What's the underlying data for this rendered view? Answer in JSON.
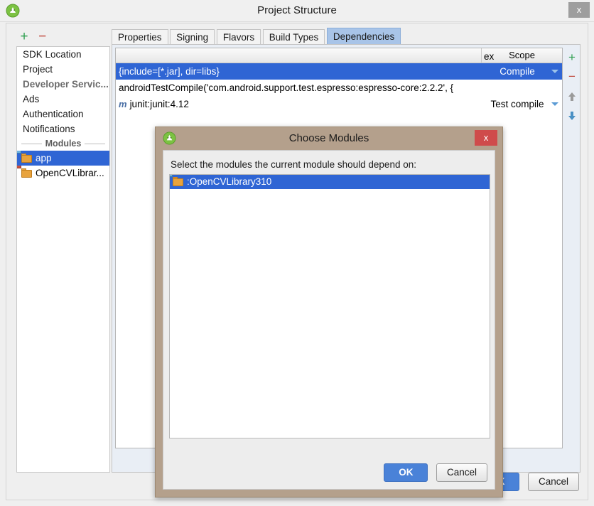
{
  "window": {
    "title": "Project Structure",
    "app_icon": "android-studio-icon",
    "close_label": "x"
  },
  "left_toolbar": {
    "add_label": "+",
    "remove_label": "−"
  },
  "sidebar": {
    "items": [
      {
        "label": "SDK Location",
        "type": "item"
      },
      {
        "label": "Project",
        "type": "item"
      },
      {
        "label": "Developer Servic...",
        "type": "group"
      },
      {
        "label": "Ads",
        "type": "item"
      },
      {
        "label": "Authentication",
        "type": "item"
      },
      {
        "label": "Notifications",
        "type": "item"
      }
    ],
    "modules_separator": "Modules",
    "modules": [
      {
        "label": "app",
        "icon": "module-folder-icon",
        "selected": true
      },
      {
        "label": "OpenCVLibrar...",
        "icon": "library-folder-icon",
        "selected": false
      }
    ]
  },
  "tabs": [
    {
      "label": "Properties",
      "active": false
    },
    {
      "label": "Signing",
      "active": false
    },
    {
      "label": "Flavors",
      "active": false
    },
    {
      "label": "Build Types",
      "active": false
    },
    {
      "label": "Dependencies",
      "active": true
    }
  ],
  "dependencies_table": {
    "columns": [
      "",
      "Scope"
    ],
    "rows": [
      {
        "name": "{include=[*.jar], dir=libs}",
        "scope": "Compile",
        "selected": true,
        "icon": "",
        "has_dropdown": true,
        "extra": ""
      },
      {
        "name": "androidTestCompile('com.android.support.test.espresso:espresso-core:2.2.2', {",
        "scope": "",
        "selected": false,
        "icon": "",
        "has_dropdown": false,
        "extra": "ex"
      },
      {
        "name": "junit:junit:4.12",
        "scope": "Test compile",
        "selected": false,
        "icon": "maven-icon",
        "icon_glyph": "m",
        "has_dropdown": true,
        "extra": ""
      }
    ],
    "toolbar": {
      "add_label": "+",
      "remove_label": "−",
      "up_label": "⬆",
      "down_label": "⬇"
    }
  },
  "main_buttons": {
    "ok_label": "OK",
    "cancel_label": "Cancel"
  },
  "dialog": {
    "title": "Choose Modules",
    "app_icon": "android-studio-icon",
    "close_label": "x",
    "prompt": "Select the modules the current module should depend on:",
    "list": [
      {
        "label": ":OpenCVLibrary310",
        "icon": "module-folder-icon",
        "selected": true
      }
    ],
    "ok_label": "OK",
    "cancel_label": "Cancel"
  },
  "colors": {
    "selection_blue": "#2f65d4",
    "tab_active": "#a8c4e8",
    "primary_button": "#4a82d8",
    "dialog_frame": "#b4a08c",
    "dialog_close_red": "#cf4b4b",
    "add_green": "#2e9e4f",
    "remove_red": "#c0483c"
  }
}
